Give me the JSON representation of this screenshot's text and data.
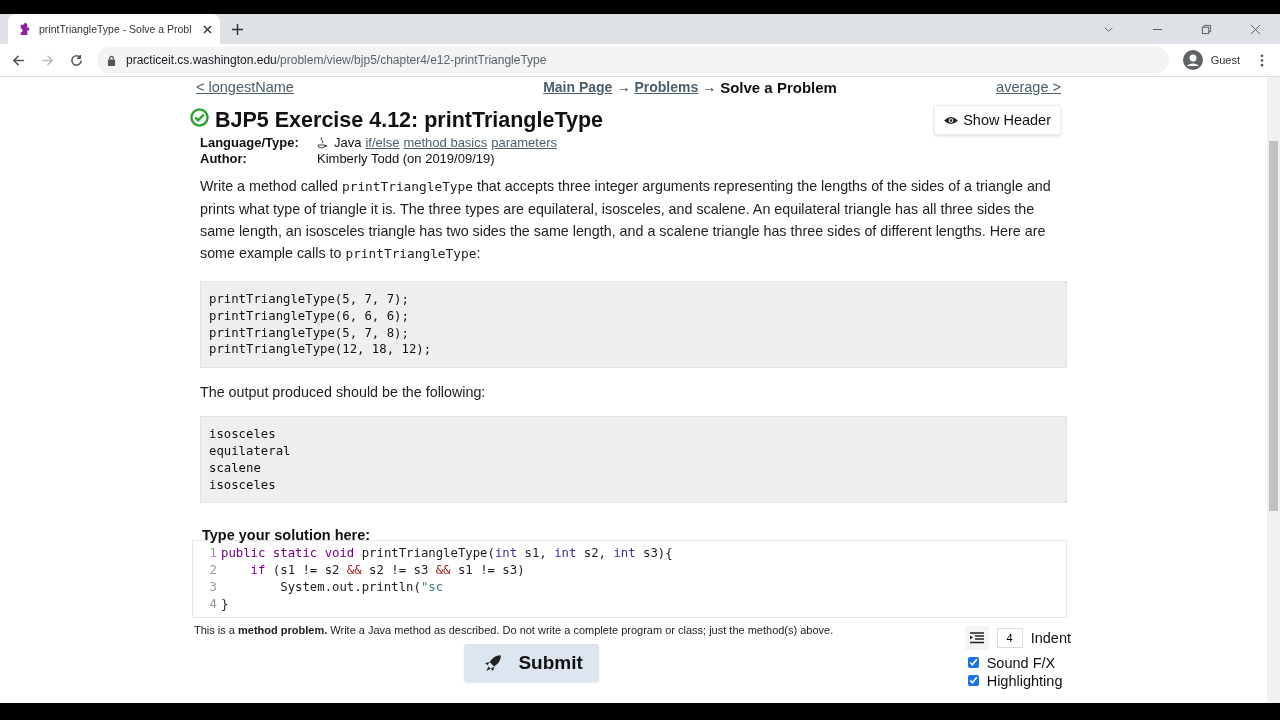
{
  "browser": {
    "tab_title": "printTriangleType - Solve a Probl",
    "url_host": "practiceit.cs.washington.edu",
    "url_path": "/problem/view/bjp5/chapter4/e12-printTriangleType",
    "profile": "Guest"
  },
  "nav": {
    "prev": "< longestName",
    "breadcrumb": [
      {
        "text": "Main Page",
        "kind": "link"
      },
      {
        "text": "→",
        "kind": "arrow"
      },
      {
        "text": "Problems",
        "kind": "link"
      },
      {
        "text": "→",
        "kind": "arrow"
      },
      {
        "text": "Solve a Problem",
        "kind": "current"
      }
    ],
    "next": "average >"
  },
  "show_header": "Show Header",
  "problem": {
    "solved": true,
    "title": "BJP5 Exercise 4.12: printTriangleType",
    "meta": [
      {
        "label": "Language/Type:",
        "parts": [
          {
            "text": "Java",
            "kind": "text"
          },
          {
            "text": "if/else",
            "kind": "link"
          },
          {
            "text": "method basics",
            "kind": "link"
          },
          {
            "text": "parameters",
            "kind": "link"
          }
        ]
      },
      {
        "label": "Author:",
        "parts": [
          {
            "text": "Kimberly Todd (on 2019/09/19)",
            "kind": "text"
          }
        ]
      }
    ],
    "description": [
      {
        "text": "Write a method called ",
        "kind": "text"
      },
      {
        "text": "printTriangleType",
        "kind": "code"
      },
      {
        "text": " that accepts three integer arguments representing the lengths of the sides of a triangle and prints what type of triangle it is. The three types are equilateral, isosceles, and scalene. An equilateral triangle has all three sides the same length, an isosceles triangle has two sides the same length, and a scalene triangle has three sides of different lengths. Here are some example calls to ",
        "kind": "text"
      },
      {
        "text": "printTriangleType",
        "kind": "code"
      },
      {
        "text": ":",
        "kind": "text"
      }
    ],
    "example_calls": [
      "printTriangleType(5, 7, 7);",
      "printTriangleType(6, 6, 6);",
      "printTriangleType(5, 7, 8);",
      "printTriangleType(12, 18, 12);"
    ],
    "output_intro": "The output produced should be the following:",
    "expected_output": [
      "isosceles",
      "equilateral",
      "scalene",
      "isosceles"
    ]
  },
  "editor": {
    "label": "Type your solution here:",
    "lines": [
      {
        "number": "1",
        "tokens": [
          {
            "text": "public static void",
            "kind": "keyword"
          },
          {
            "text": " printTriangleType(",
            "kind": "plain"
          },
          {
            "text": "int",
            "kind": "type"
          },
          {
            "text": " s1, ",
            "kind": "plain"
          },
          {
            "text": "int",
            "kind": "type"
          },
          {
            "text": " s2, ",
            "kind": "plain"
          },
          {
            "text": "int",
            "kind": "type"
          },
          {
            "text": " s3){",
            "kind": "plain"
          }
        ]
      },
      {
        "number": "2",
        "tokens": [
          {
            "text": "    if",
            "kind": "keyword"
          },
          {
            "text": " (s1 != s2 ",
            "kind": "plain"
          },
          {
            "text": "&&",
            "kind": "operator"
          },
          {
            "text": " s2 != s3 ",
            "kind": "plain"
          },
          {
            "text": "&&",
            "kind": "operator"
          },
          {
            "text": " s1 != s3)",
            "kind": "plain"
          }
        ]
      },
      {
        "number": "3",
        "tokens": [
          {
            "text": "        System.out.println(",
            "kind": "plain"
          },
          {
            "text": "\"sc",
            "kind": "string"
          }
        ]
      },
      {
        "number": "4",
        "tokens": [
          {
            "text": "}",
            "kind": "plain"
          }
        ]
      }
    ]
  },
  "note": "This is a **method problem.** Write a Java method as described. Do not write a complete program or class; just the method(s) above.",
  "submit": "Submit",
  "indent": {
    "value": "4",
    "label": "Indent"
  },
  "options": [
    {
      "label": "Sound F/X",
      "checked": true
    },
    {
      "label": "Highlighting",
      "checked": true
    }
  ]
}
